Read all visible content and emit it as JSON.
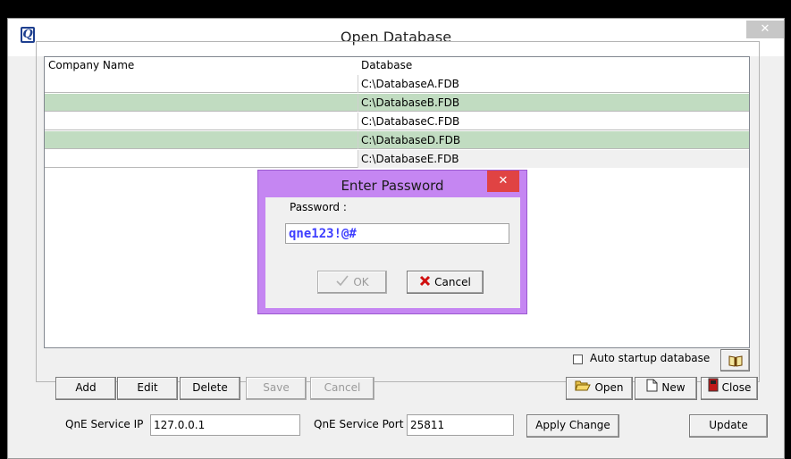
{
  "window": {
    "title": "Open Database",
    "close_glyph": "✕",
    "icon_letter": "Q"
  },
  "list": {
    "columns": [
      "Company Name",
      "Database"
    ],
    "rows": [
      {
        "company": "",
        "database": "C:\\DatabaseA.FDB",
        "highlight": false
      },
      {
        "company": "",
        "database": "C:\\DatabaseB.FDB",
        "highlight": true
      },
      {
        "company": "",
        "database": "C:\\DatabaseC.FDB",
        "highlight": false
      },
      {
        "company": "",
        "database": "C:\\DatabaseD.FDB",
        "highlight": true
      },
      {
        "company": "",
        "database": "C:\\DatabaseE.FDB",
        "highlight": false
      }
    ]
  },
  "dialog": {
    "title": "Enter Password",
    "close_glyph": "✕",
    "password_label": "Password :",
    "password_value": "qne123!@#",
    "ok_label": "OK",
    "cancel_label": "Cancel"
  },
  "actions": {
    "add": "Add",
    "edit": "Edit",
    "delete": "Delete",
    "save": "Save",
    "cancel": "Cancel",
    "open": "Open",
    "new": "New",
    "close": "Close"
  },
  "auto_startup": {
    "label": "Auto startup database",
    "checked": false
  },
  "service": {
    "ip_label": "QnE Service IP",
    "ip_value": "127.0.0.1",
    "port_label": "QnE Service Port",
    "port_value": "25811",
    "apply_label": "Apply Change",
    "update_label": "Update"
  },
  "colors": {
    "row_highlight": "#c1dcc1",
    "row_last": "#f0f0f0",
    "dialog_frame": "#c586f2",
    "dialog_close": "#e04343",
    "password_text": "#3e3eff"
  },
  "icons": {
    "app": "qne-logo-icon",
    "ok": "check-icon",
    "cancel": "red-x-icon",
    "open": "folder-open-icon",
    "new": "new-document-icon",
    "close": "exit-door-icon",
    "browse": "book-icon"
  }
}
